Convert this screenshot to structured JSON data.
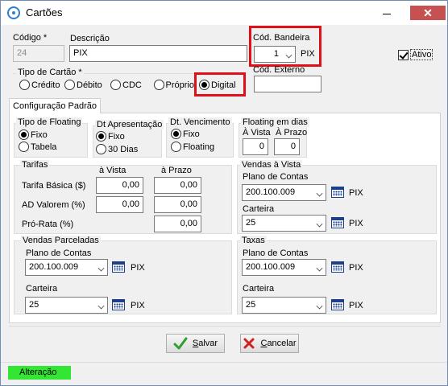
{
  "window": {
    "title": "Cartões",
    "minimize_symbol": "",
    "close_symbol": "✕"
  },
  "header": {
    "codigo_label": "Código *",
    "codigo_value": "24",
    "descricao_label": "Descrição",
    "descricao_value": "PIX",
    "cod_bandeira_label": "Cód. Bandeira",
    "cod_bandeira_value": "1",
    "cod_bandeira_text": "PIX",
    "ativo_label": "Ativo",
    "ativo_checked": true,
    "cod_externo_label": "Cód. Externo",
    "cod_externo_value": ""
  },
  "tipo_cartao": {
    "label": "Tipo de Cartão  *",
    "options": [
      "Crédito",
      "Débito",
      "CDC",
      "Próprio",
      "Digital"
    ],
    "selected": "Digital"
  },
  "tabs": [
    {
      "label": "Configuração Padrão",
      "active": true
    }
  ],
  "tipo_floating": {
    "label": "Tipo de Floating",
    "options": [
      "Fixo",
      "Tabela"
    ],
    "selected": "Fixo"
  },
  "dt_apresentacao": {
    "label": "Dt Apresentação",
    "options": [
      "Fixo",
      "30 Dias"
    ],
    "selected": "Fixo"
  },
  "dt_vencimento": {
    "label": "Dt. Vencimento",
    "options": [
      "Fixo",
      "Floating"
    ],
    "selected": "Fixo"
  },
  "floating_dias": {
    "label": "Floating em dias",
    "a_vista_label": "À Vista",
    "a_prazo_label": "À Prazo",
    "a_vista_value": "0",
    "a_prazo_value": "0"
  },
  "tarifas": {
    "label": "Tarifas",
    "col_a_vista": "à Vista",
    "col_a_prazo": "à Prazo",
    "rows": [
      {
        "label": "Tarifa Básica ($)",
        "a_vista": "0,00",
        "a_prazo": "0,00"
      },
      {
        "label": "AD Valorem (%)",
        "a_vista": "0,00",
        "a_prazo": "0,00"
      },
      {
        "label": "Pró-Rata (%)",
        "a_prazo": "0,00"
      }
    ]
  },
  "vendas_a_vista": {
    "label": "Vendas à Vista",
    "plano_label": "Plano de Contas",
    "plano_value": "200.100.009",
    "plano_text": "PIX",
    "carteira_label": "Carteira",
    "carteira_value": "25",
    "carteira_text": "PIX"
  },
  "vendas_parceladas": {
    "label": "Vendas Parceladas",
    "plano_label": "Plano de Contas",
    "plano_value": "200.100.009",
    "plano_text": "PIX",
    "carteira_label": "Carteira",
    "carteira_value": "25",
    "carteira_text": "PIX"
  },
  "taxas": {
    "label": "Taxas",
    "plano_label": "Plano de Contas",
    "plano_value": "200.100.009",
    "plano_text": "PIX",
    "carteira_label": "Carteira",
    "carteira_value": "25",
    "carteira_text": "PIX"
  },
  "buttons": {
    "salvar_label_first": "S",
    "salvar_label_rest": "alvar",
    "cancelar_label_first": "C",
    "cancelar_label_rest": "ancelar"
  },
  "status": {
    "mode": "Alteração",
    "color": "#33e633"
  },
  "colors": {
    "highlight": "#e0101a",
    "close": "#c75050",
    "icon_blue": "#1c3f8c"
  }
}
